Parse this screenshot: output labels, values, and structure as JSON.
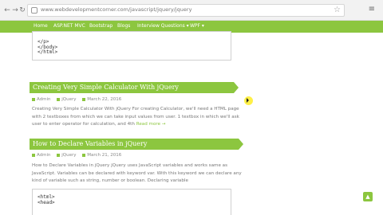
{
  "browser": {
    "url": "www.webdevelopmentcorner.com/javascript/jquery/jquery",
    "back_icon": "back-arrow-icon",
    "forward_icon": "forward-arrow-icon",
    "refresh_icon": "refresh-icon"
  },
  "nav": {
    "items": [
      "Home",
      "ASP.NET MVC",
      "Bootstrap",
      "Blogs",
      "Interview Questions ▾",
      "WPF ▾"
    ]
  },
  "code_top": {
    "lines": [
      "</p>",
      "</body>",
      "</html>"
    ]
  },
  "posts": [
    {
      "title": "Creating Very Simple Calculator With jQuery",
      "author": "Admin",
      "category": "jQuery",
      "date": "March 22, 2016",
      "excerpt_lines": [
        "Creating Very Simple Calculator With jQuery For creating Calculator, we'll need a HTML page",
        "with 2 textboxes from which we can take input values from user. 1 textbox in which we'll ask",
        "user to enter operator for calculation, and 4th"
      ],
      "read_more": "Read more →"
    },
    {
      "title": "How to Declare Variables in jQuery",
      "author": "Admin",
      "category": "jQuery",
      "date": "March 21, 2016",
      "excerpt_lines": [
        "How to Declare Variables in jQuery jQuery uses JavaScript variables and works same as",
        "JavaScript. Variables can be declared with keyword var. With this keyword we can declare any",
        "kind of variable such as string, number or boolean.  Declaring variable"
      ],
      "code_lines": [
        "<html>",
        "<head>"
      ]
    }
  ],
  "colors": {
    "accent": "#8cc63f"
  }
}
